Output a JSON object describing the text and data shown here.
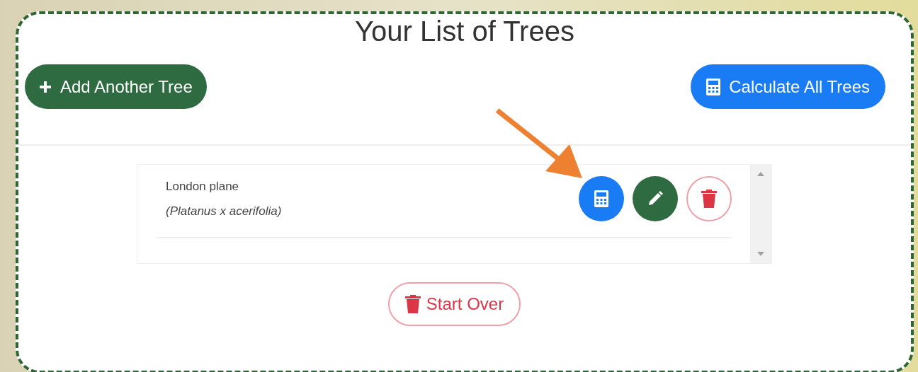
{
  "title": "Your List of Trees",
  "add_button": {
    "label": "Add Another Tree"
  },
  "calculate_all_button": {
    "label": "Calculate All Trees"
  },
  "trees": [
    {
      "common_name": "London plane",
      "scientific_name": "(Platanus x acerifolia)"
    }
  ],
  "start_over_button": {
    "label": "Start Over"
  }
}
